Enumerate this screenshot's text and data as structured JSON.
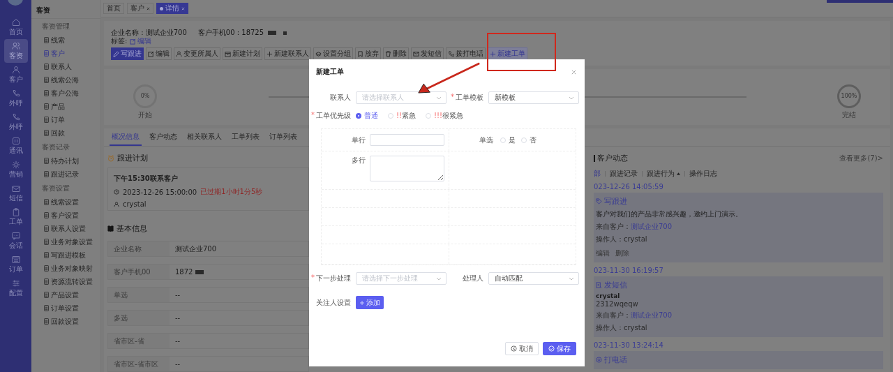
{
  "rail": {
    "items": [
      {
        "label": "首页",
        "selected": false
      },
      {
        "label": "客资",
        "selected": true
      },
      {
        "label": "客户",
        "selected": false
      },
      {
        "label": "外呼",
        "selected": false
      },
      {
        "label": "外呼",
        "selected": false
      },
      {
        "label": "通讯",
        "selected": false
      },
      {
        "label": "营销",
        "selected": false
      },
      {
        "label": "短信",
        "selected": false
      },
      {
        "label": "工单",
        "selected": false
      },
      {
        "label": "会话",
        "selected": false
      },
      {
        "label": "订单",
        "selected": false
      },
      {
        "label": "配置",
        "selected": false
      }
    ]
  },
  "submenu": {
    "title": "客资",
    "groups": [
      {
        "title": "客资管理",
        "items": [
          {
            "label": "线索",
            "selected": false
          },
          {
            "label": "客户",
            "selected": true
          },
          {
            "label": "联系人",
            "selected": false
          },
          {
            "label": "线索公海",
            "selected": false
          },
          {
            "label": "客户公海",
            "selected": false
          },
          {
            "label": "产品",
            "selected": false
          },
          {
            "label": "订单",
            "selected": false
          },
          {
            "label": "回款",
            "selected": false
          }
        ]
      },
      {
        "title": "客资记录",
        "items": [
          {
            "label": "待办计划",
            "selected": false
          },
          {
            "label": "跟进记录",
            "selected": false
          }
        ]
      },
      {
        "title": "客资设置",
        "items": [
          {
            "label": "线索设置",
            "selected": false
          },
          {
            "label": "客户设置",
            "selected": false
          },
          {
            "label": "联系人设置",
            "selected": false
          },
          {
            "label": "业务对象设置",
            "selected": false
          },
          {
            "label": "写跟进模板",
            "selected": false
          },
          {
            "label": "业务对象映射",
            "selected": false
          },
          {
            "label": "资源流转设置",
            "selected": false
          },
          {
            "label": "产品设置",
            "selected": false
          },
          {
            "label": "订单设置",
            "selected": false
          },
          {
            "label": "回款设置",
            "selected": false
          }
        ]
      }
    ]
  },
  "page_tabs": [
    {
      "label": "首页",
      "closable": false,
      "selected": false
    },
    {
      "label": "客户",
      "closable": true,
      "selected": false
    },
    {
      "label": "详情",
      "closable": true,
      "selected": true
    }
  ],
  "header": {
    "company": "企业名称 : 测试企业700",
    "phone": "客户手机00 : 18725",
    "phone_redacted": true,
    "tag_label": "标签:",
    "tag_edit": "编辑"
  },
  "actions": [
    {
      "label": "写跟进",
      "kind": "primary"
    },
    {
      "label": "编辑",
      "kind": "default"
    },
    {
      "label": "变更所属人",
      "kind": "default"
    },
    {
      "label": "新建计划",
      "kind": "default"
    },
    {
      "label": "新建联系人",
      "kind": "default"
    },
    {
      "label": "设置分组",
      "kind": "default"
    },
    {
      "label": "放弃",
      "kind": "default"
    },
    {
      "label": "删除",
      "kind": "default"
    },
    {
      "label": "发短信",
      "kind": "default"
    },
    {
      "label": "拨打电话",
      "kind": "default"
    },
    {
      "label": "新建工单",
      "kind": "highlighted"
    }
  ],
  "progress": {
    "start": {
      "percent": "0%",
      "label": "开始"
    },
    "end": {
      "percent": "100%",
      "label": "完结"
    }
  },
  "detail_tabs": [
    {
      "label": "概况信息",
      "selected": true
    },
    {
      "label": "客户动态",
      "selected": false
    },
    {
      "label": "相关联系人",
      "selected": false
    },
    {
      "label": "工单列表",
      "selected": false
    },
    {
      "label": "订单列表",
      "selected": false
    }
  ],
  "follow_plan": {
    "title": "跟进计划",
    "task": "下午15:30联系客户",
    "time": "2023-12-26 15:00:00",
    "overdue": "已过期1小时1分5秒",
    "owner": "crystal"
  },
  "basic_info": {
    "title": "基本信息",
    "rows": [
      {
        "label": "企业名称",
        "value": "测试企业700"
      },
      {
        "label": "客户手机00",
        "value": "1872",
        "redacted": true
      },
      {
        "label": "单选",
        "value": "--"
      },
      {
        "label": "多选",
        "value": "--"
      },
      {
        "label": "省市区-省",
        "value": "--"
      },
      {
        "label": "省市区-省市区",
        "value": "--"
      }
    ]
  },
  "activity": {
    "title": "客户动态",
    "more": "查看更多(7)>",
    "filters": [
      {
        "label": "部",
        "selected": true
      },
      {
        "label": "跟进记录",
        "selected": false
      },
      {
        "label": "跟进行为",
        "selected": false,
        "caret": true
      },
      {
        "label": "操作日志",
        "selected": false
      }
    ],
    "entries": [
      {
        "date": "023-12-26 14:05:59",
        "kind": "follow",
        "title": "写跟进",
        "text": "客户对我们的产品非常感兴趣，邀约上门演示。",
        "source_label": "来自客户：",
        "source": "测试企业700",
        "operator": "操作人：crystal",
        "actions": [
          "编辑",
          "删除"
        ]
      },
      {
        "date": "023-11-30 16:19:57",
        "kind": "sms",
        "title": "发短信",
        "author": "crystal",
        "text": "2312wqeqw",
        "source_label": "来自客户：",
        "source": "测试企业700",
        "operator": "操作人：crystal"
      },
      {
        "date": "023-11-30 13:24:14",
        "kind": "call",
        "title": "打电话"
      }
    ]
  },
  "modal": {
    "title": "新建工单",
    "contact": {
      "label": "联系人",
      "placeholder": "请选择联系人"
    },
    "template": {
      "label": "工单模板",
      "required_mark": "*",
      "value": "新模板"
    },
    "priority": {
      "label": "工单优先级",
      "required_mark": "*",
      "options": [
        {
          "label": "普通",
          "selected": true
        },
        {
          "mark": "!!",
          "label": "紧急",
          "selected": false
        },
        {
          "mark": "!!!",
          "label": "很紧急",
          "selected": false
        }
      ]
    },
    "custom_form": {
      "single_line": {
        "label": "单行"
      },
      "radio": {
        "label": "单选",
        "options": [
          {
            "label": "是",
            "selected": false
          },
          {
            "label": "否",
            "selected": false
          }
        ]
      },
      "multi_line": {
        "label": "多行"
      }
    },
    "next_step": {
      "label": "下一步处理",
      "required_mark": "*",
      "placeholder": "请选择下一步处理"
    },
    "handler": {
      "label": "处理人",
      "value": "自动匹配"
    },
    "watchers": {
      "label": "关注人设置",
      "button": "添加"
    },
    "buttons": [
      {
        "label": "取消",
        "kind": "default"
      },
      {
        "label": "保存",
        "kind": "primary"
      }
    ]
  }
}
